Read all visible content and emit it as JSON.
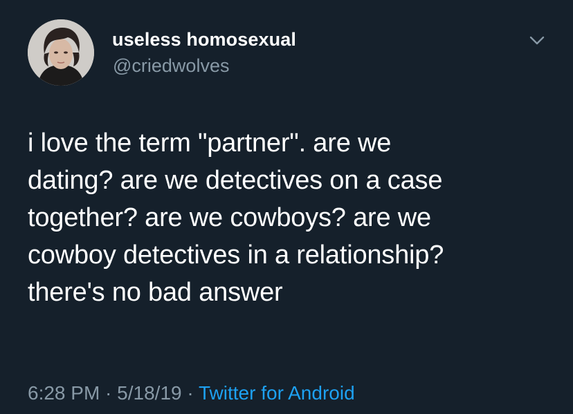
{
  "user": {
    "display_name": "useless homosexual",
    "handle": "@criedwolves"
  },
  "tweet": {
    "text_lines": [
      "i love the term \"partner\". are we",
      "dating? are we detectives on a case",
      "together? are we cowboys? are we",
      "cowboy detectives in a relationship?",
      "there's no bad answer"
    ]
  },
  "meta": {
    "time": "6:28 PM",
    "separator": " · ",
    "date": "5/18/19",
    "source": "Twitter for Android"
  },
  "icons": {
    "menu": "chevron-down-icon"
  },
  "colors": {
    "background": "#15202b",
    "text": "#ffffff",
    "secondary_text": "#8899a6",
    "link": "#1da1f2"
  }
}
